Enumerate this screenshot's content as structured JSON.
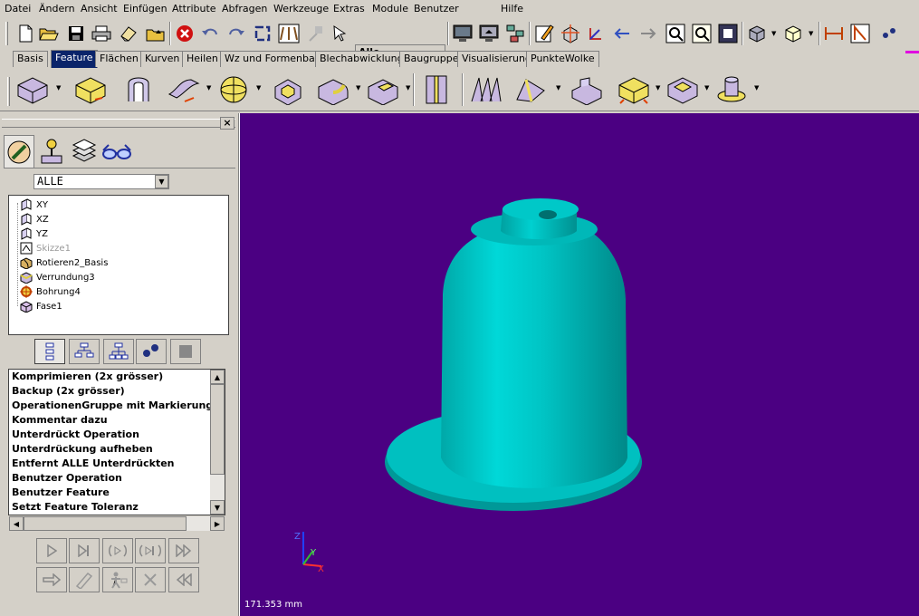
{
  "menu": [
    "Datei",
    "Ändern",
    "Ansicht",
    "Einfügen",
    "Attribute",
    "Abfragen",
    "Werkzeuge",
    "Extras",
    "Module",
    "Benutzer",
    "Hilfe"
  ],
  "toolbar": {
    "filter_value": "Alle",
    "icons": [
      "new-file-icon",
      "open-folder-icon",
      "save-icon",
      "print-icon",
      "eraser-icon",
      "folder-up-icon",
      "cancel-icon",
      "undo-icon",
      "redo-icon",
      "refresh-icon",
      "constraint-icon",
      "select-filter-icon",
      "pointer-icon"
    ]
  },
  "tabs": [
    "Basis",
    "Feature",
    "Flächen",
    "Kurven",
    "Heilen",
    "Wz und Formenbau",
    "Blechabwicklung",
    "Baugruppe",
    "Visualisierung",
    "PunkteWolke"
  ],
  "active_tab": "Feature",
  "panel": {
    "filter": "ALLE",
    "tree": [
      {
        "label": "XY",
        "icon": "plane-icon",
        "dim": false
      },
      {
        "label": "XZ",
        "icon": "plane-icon",
        "dim": false
      },
      {
        "label": "YZ",
        "icon": "plane-icon",
        "dim": false
      },
      {
        "label": "Skizze1",
        "icon": "sketch-icon",
        "dim": true
      },
      {
        "label": "Rotieren2_Basis",
        "icon": "revolve-icon",
        "dim": false
      },
      {
        "label": "Verrundung3",
        "icon": "fillet-icon",
        "dim": false
      },
      {
        "label": "Bohrung4",
        "icon": "hole-icon",
        "dim": false
      },
      {
        "label": "Fase1",
        "icon": "chamfer-icon",
        "dim": false
      }
    ],
    "operations": [
      "Komprimieren (2x grösser)",
      "Backup (2x grösser)",
      "OperationenGruppe mit Markierung",
      "Kommentar dazu",
      "Unterdrückt Operation",
      "Unterdrückung aufheben",
      "Entfernt ALLE Unterdrückten",
      "Benutzer Operation",
      "Benutzer Feature",
      "Setzt Feature Toleranz"
    ]
  },
  "viewport": {
    "background": "#4b0082",
    "model_color": "#00c8c8",
    "scale_readout": "171.353 mm",
    "axis_labels": [
      "X",
      "Y",
      "Z"
    ]
  }
}
